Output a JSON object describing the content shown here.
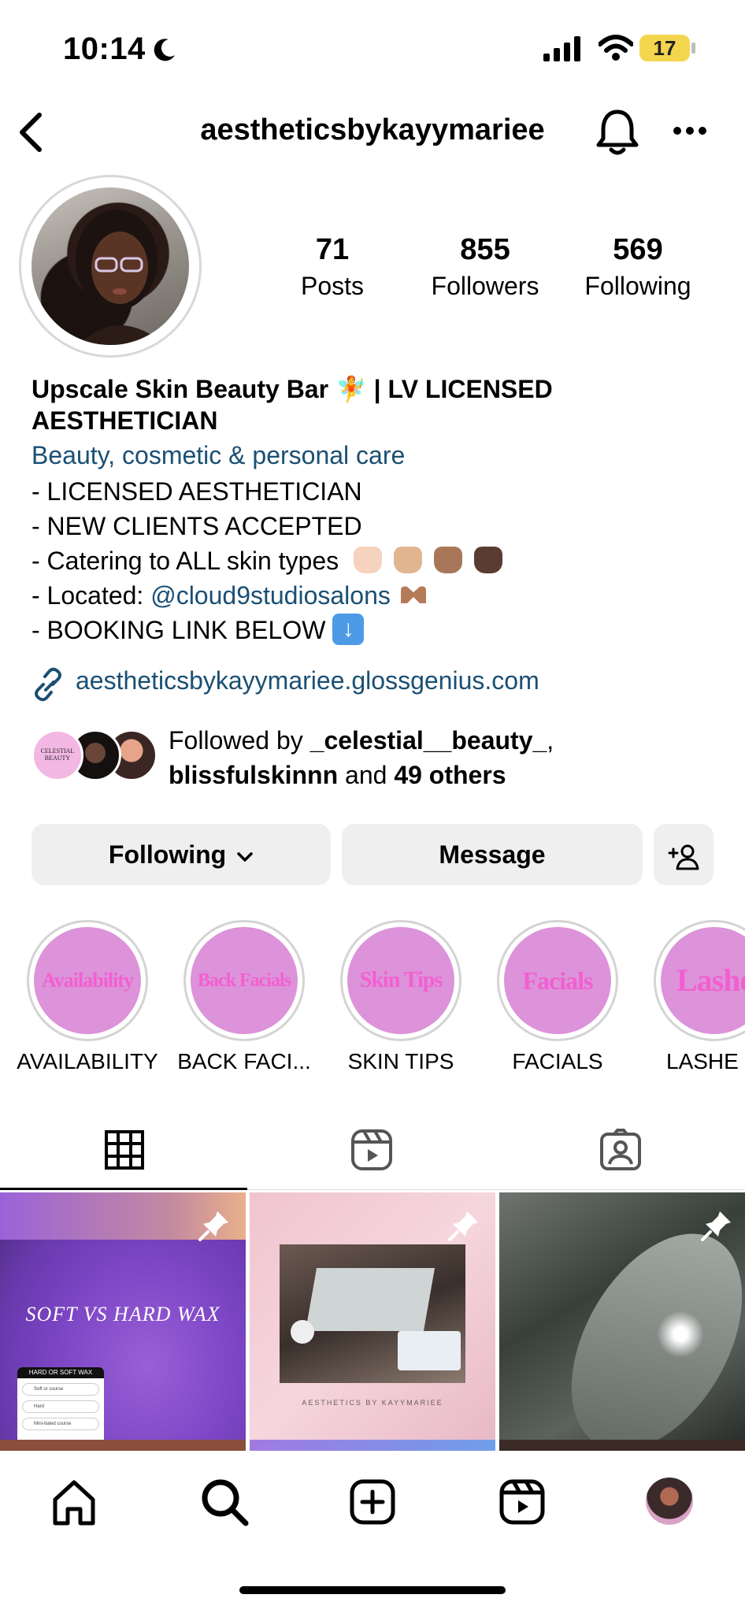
{
  "status_bar": {
    "time": "10:14",
    "battery": "17"
  },
  "header": {
    "username": "aestheticsbykayymariee"
  },
  "stats": [
    {
      "value": "71",
      "label": "Posts"
    },
    {
      "value": "855",
      "label": "Followers"
    },
    {
      "value": "569",
      "label": "Following"
    }
  ],
  "bio": {
    "name_line": "Upscale Skin Beauty Bar 🧚 | LV LICENSED AESTHETICIAN",
    "category": "Beauty, cosmetic & personal care",
    "line1": "- LICENSED AESTHETICIAN",
    "line2": "- NEW CLIENTS ACCEPTED",
    "line3": "- Catering to ALL skin types",
    "line4_prefix": "- Located:",
    "line4_mention": "@cloud9studiosalons",
    "line5": "- BOOKING LINK BELOW",
    "link": "aestheticsbykayymariee.glossgenius.com"
  },
  "followed_by": {
    "prefix": "Followed by",
    "user1": "_celestial__beauty_",
    "comma": ",",
    "user2": "blissfulskinnn",
    "and": "and",
    "others": "49 others",
    "avatar1_text": "CELESTIAL BEAUTY"
  },
  "actions": {
    "following": "Following",
    "message": "Message"
  },
  "highlights": [
    {
      "label": "AVAILABILITY",
      "cover": "Availability"
    },
    {
      "label": "BACK FACI...",
      "cover": "Back Facials"
    },
    {
      "label": "SKIN TIPS",
      "cover": "Skin Tips"
    },
    {
      "label": "FACIALS",
      "cover": "Facials"
    },
    {
      "label": "LASHE",
      "cover": "Lashes"
    }
  ],
  "posts": {
    "tile1_title": "SOFT VS HARD WAX",
    "tile1_card_title": "HARD OR SOFT WAX",
    "tile1_options": [
      "Soft or course",
      "Hard",
      "Mini-itated course"
    ],
    "tile2_caption": "AESTHETICS BY KAYYMARIEE"
  },
  "colors": {
    "link": "#1a4f74",
    "highlight_bg": "#dc93d9",
    "battery": "#f4d64e"
  }
}
